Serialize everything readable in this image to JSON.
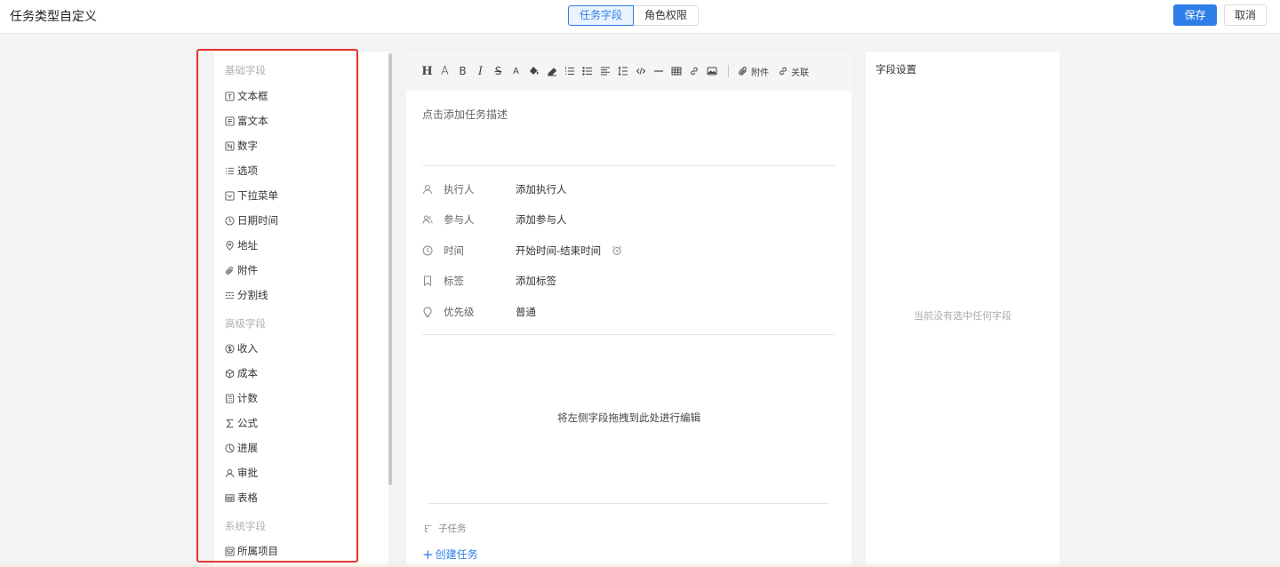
{
  "header": {
    "title": "任务类型自定义",
    "tabs": [
      {
        "label": "任务字段",
        "active": true
      },
      {
        "label": "角色权限",
        "active": false
      }
    ],
    "save_label": "保存",
    "cancel_label": "取消"
  },
  "colors": {
    "accent": "#2f7ee8",
    "highlight_frame": "#e5322d"
  },
  "field_library": {
    "basic_title": "基础字段",
    "basic": [
      {
        "label": "文本框",
        "icon": "text-box-icon"
      },
      {
        "label": "富文本",
        "icon": "rich-text-icon"
      },
      {
        "label": "数字",
        "icon": "number-icon"
      },
      {
        "label": "选项",
        "icon": "list-options-icon"
      },
      {
        "label": "下拉菜单",
        "icon": "dropdown-icon"
      },
      {
        "label": "日期时间",
        "icon": "clock-icon"
      },
      {
        "label": "地址",
        "icon": "location-pin-icon"
      },
      {
        "label": "附件",
        "icon": "paperclip-icon"
      },
      {
        "label": "分割线",
        "icon": "divider-icon"
      }
    ],
    "advanced_title": "高级字段",
    "advanced": [
      {
        "label": "收入",
        "icon": "dollar-icon"
      },
      {
        "label": "成本",
        "icon": "cube-icon"
      },
      {
        "label": "计数",
        "icon": "calculator-icon"
      },
      {
        "label": "公式",
        "icon": "sigma-icon"
      },
      {
        "label": "进展",
        "icon": "progress-pie-icon"
      },
      {
        "label": "审批",
        "icon": "user-icon"
      },
      {
        "label": "表格",
        "icon": "table-icon"
      }
    ],
    "system_title": "系统字段",
    "system": [
      {
        "label": "所属项目",
        "icon": "project-icon"
      }
    ]
  },
  "editor": {
    "toolbar": {
      "attachment_label": "附件",
      "relation_label": "关联"
    },
    "description_placeholder": "点击添加任务描述",
    "properties": [
      {
        "label": "执行人",
        "value": "添加执行人",
        "icon": "user-icon"
      },
      {
        "label": "参与人",
        "value": "添加参与人",
        "icon": "users-icon"
      },
      {
        "label": "时间",
        "value": "开始时间-结束时间",
        "icon": "clock-icon"
      },
      {
        "label": "标签",
        "value": "添加标签",
        "icon": "bookmark-icon"
      },
      {
        "label": "优先级",
        "value": "普通",
        "icon": "bulb-icon"
      }
    ],
    "drop_hint": "将左侧字段拖拽到此处进行编辑",
    "subtask_label": "子任务",
    "create_task_label": "创建任务"
  },
  "field_settings": {
    "title": "字段设置",
    "empty_text": "当前没有选中任何字段"
  }
}
